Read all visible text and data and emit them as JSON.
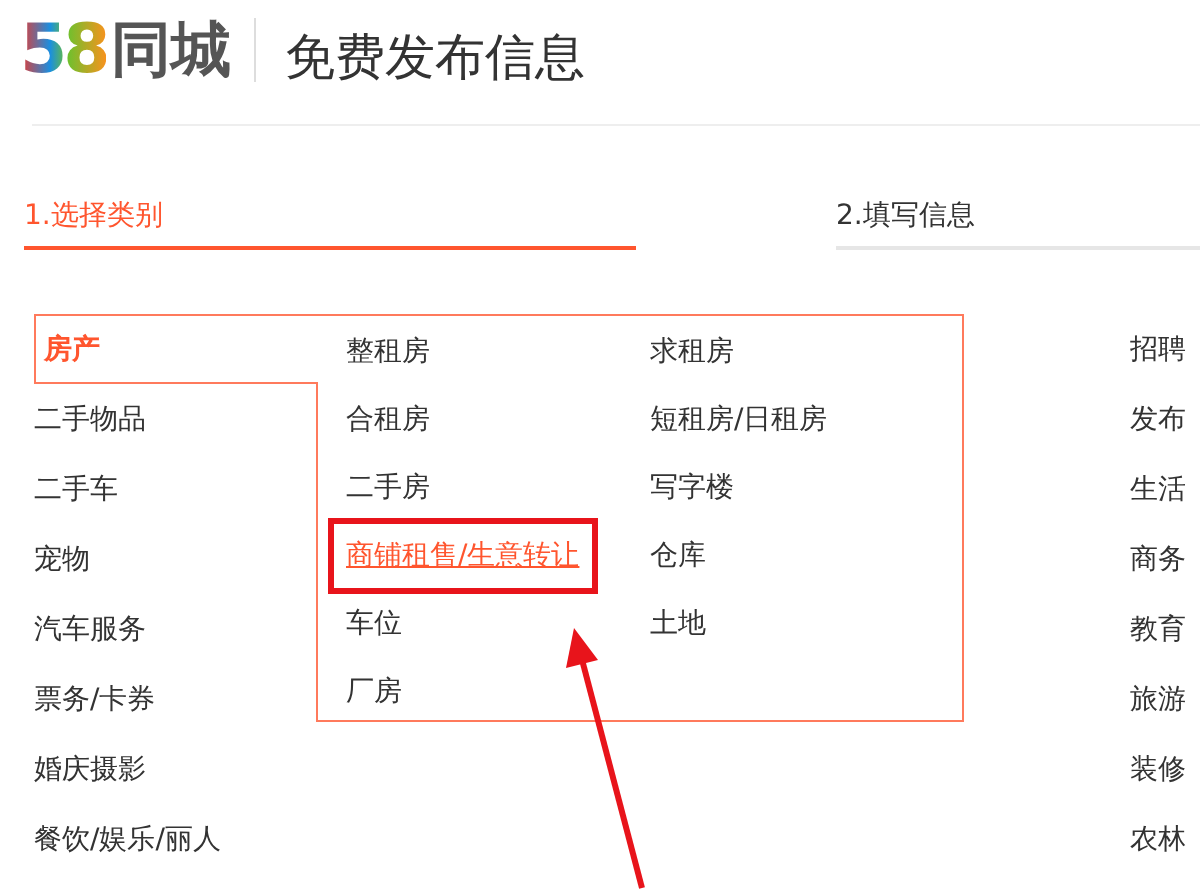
{
  "logo": {
    "number": "58",
    "name": "同城"
  },
  "page_title": "免费发布信息",
  "steps": [
    {
      "label": "1.选择类别",
      "selected": true
    },
    {
      "label": "2.填写信息",
      "selected": false
    }
  ],
  "categories": [
    {
      "label": "房产",
      "selected": true
    },
    {
      "label": "二手物品",
      "selected": false
    },
    {
      "label": "二手车",
      "selected": false
    },
    {
      "label": "宠物",
      "selected": false
    },
    {
      "label": "汽车服务",
      "selected": false
    },
    {
      "label": "票务/卡券",
      "selected": false
    },
    {
      "label": "婚庆摄影",
      "selected": false
    },
    {
      "label": "餐饮/娱乐/丽人",
      "selected": false
    }
  ],
  "subcategories": [
    {
      "label": "整租房",
      "selected": false
    },
    {
      "label": "求租房",
      "selected": false
    },
    {
      "label": "合租房",
      "selected": false
    },
    {
      "label": "短租房/日租房",
      "selected": false
    },
    {
      "label": "二手房",
      "selected": false
    },
    {
      "label": "写字楼",
      "selected": false
    },
    {
      "label": "商铺租售/生意转让",
      "selected": true
    },
    {
      "label": "仓库",
      "selected": false
    },
    {
      "label": "车位",
      "selected": false
    },
    {
      "label": "土地",
      "selected": false
    },
    {
      "label": "厂房",
      "selected": false
    }
  ],
  "more_categories": [
    "招聘",
    "发布",
    "生活",
    "商务",
    "教育",
    "旅游",
    "装修",
    "农林"
  ]
}
